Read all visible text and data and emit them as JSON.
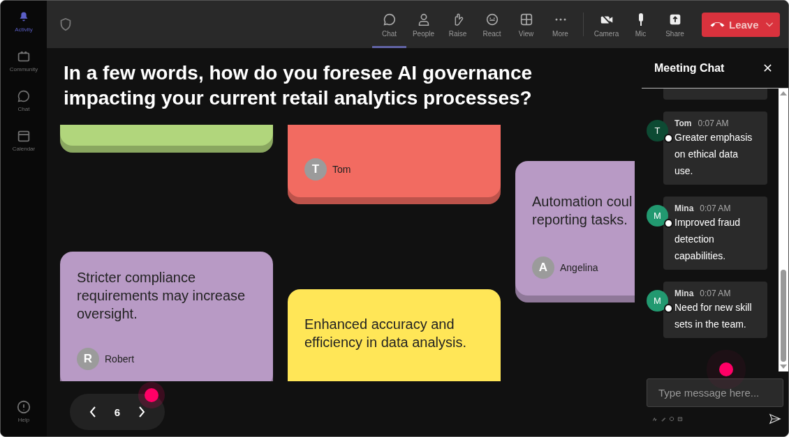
{
  "sidebar": {
    "items": [
      {
        "label": "Activity",
        "selected": true
      },
      {
        "label": "Community",
        "selected": false
      },
      {
        "label": "Chat",
        "selected": false
      },
      {
        "label": "Calendar",
        "selected": false
      }
    ],
    "help": {
      "label": "Help"
    }
  },
  "toolbar": {
    "items": [
      {
        "label": "Chat",
        "selected": true
      },
      {
        "label": "People",
        "selected": false
      },
      {
        "label": "Raise",
        "selected": false
      },
      {
        "label": "React",
        "selected": false
      },
      {
        "label": "View",
        "selected": false
      },
      {
        "label": "More",
        "selected": false
      },
      {
        "label": "Camera",
        "selected": false
      },
      {
        "label": "Mic",
        "selected": false
      },
      {
        "label": "Share",
        "selected": false
      }
    ],
    "leave": {
      "label": "Leave"
    }
  },
  "question": "In a few words, how do you foresee AI governance impacting your current retail analytics processes?",
  "cards": [
    {
      "color": "#b1d67c"
    },
    {
      "author": "Tom",
      "initial": "T",
      "color": "#f26b61"
    },
    {
      "text": "Automation coul\nreporting tasks.",
      "author": "Angelina",
      "initial": "A",
      "color": "#b89ac5"
    },
    {
      "text": "Stricter compliance requirements may increase oversight.",
      "author": "Robert",
      "initial": "R",
      "color": "#b89ac5"
    },
    {
      "text": "Enhanced accuracy and efficiency in data analysis.",
      "color": "#ffe657"
    }
  ],
  "pager": {
    "page": "6"
  },
  "chat": {
    "title": "Meeting Chat",
    "messages": [
      {
        "kind": "partial"
      },
      {
        "name": "Tom",
        "time": "0:07 AM",
        "text": "Greater emphasis on ethical data use.",
        "initial": "T",
        "color": "#0d4a33"
      },
      {
        "name": "Mina",
        "time": "0:07 AM",
        "text": "Improved fraud detection capabilities.",
        "initial": "M",
        "color": "#229970"
      },
      {
        "name": "Mina",
        "time": "0:07 AM",
        "text": "Need for new skill sets in the team.",
        "initial": "M",
        "color": "#229970"
      }
    ],
    "input": {
      "placeholder": "Type message here..."
    }
  }
}
